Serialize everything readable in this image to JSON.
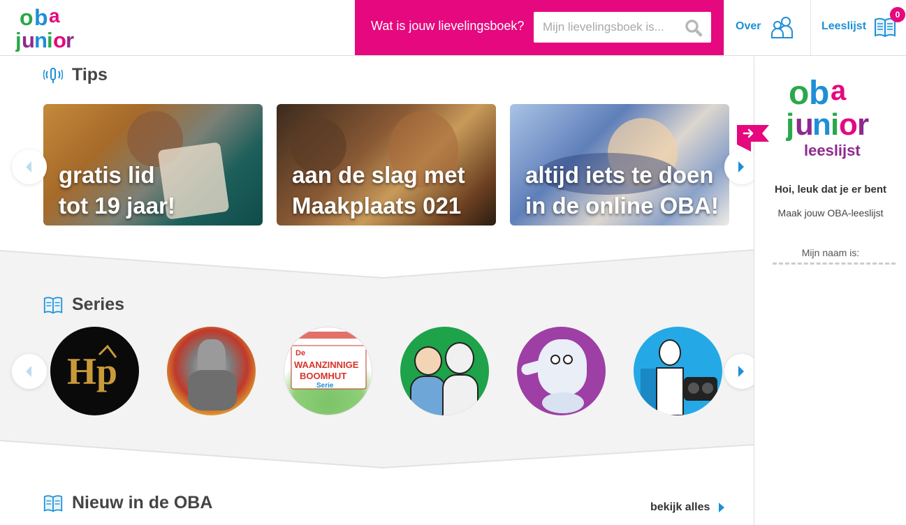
{
  "header": {
    "logo_top": "oba",
    "logo_bottom": "junior",
    "search_prompt": "Wat is jouw lievelingsboek?",
    "search_placeholder": "Mijn lievelingsboek is...",
    "nav_over": "Over",
    "nav_leeslijst": "Leeslijst",
    "leeslijst_count": "0"
  },
  "tips": {
    "heading": "Tips",
    "cards": [
      {
        "line1": "gratis lid",
        "line2": "tot 19 jaar!"
      },
      {
        "line1": "aan de slag met",
        "line2": "Maakplaats 021"
      },
      {
        "line1": "altijd iets te doen",
        "line2": "in de online OBA!"
      }
    ]
  },
  "series": {
    "heading": "Series",
    "items": [
      {
        "name": "harry-potter",
        "label": "Hp"
      },
      {
        "name": "ridder",
        "label": ""
      },
      {
        "name": "waanzinnige-boomhut",
        "label_de": "De",
        "label_main1": "WAANZINNIGE",
        "label_main2": "BOOMHUT",
        "label_serie": "Serie"
      },
      {
        "name": "dikkie-dik",
        "label": ""
      },
      {
        "name": "monster",
        "label": ""
      },
      {
        "name": "leven-van-een-loser",
        "label": ""
      }
    ]
  },
  "nieuw": {
    "heading": "Nieuw in de OBA",
    "bekijk_alles": "bekijk alles"
  },
  "sidebar": {
    "logo_top": "oba",
    "logo_bottom": "junior",
    "logo_sub": "leeslijst",
    "greeting": "Hoi, leuk dat je er bent",
    "subtitle": "Maak jouw OBA-leeslijst",
    "name_label": "Mijn naam is:"
  },
  "colors": {
    "pink": "#e5087e",
    "blue": "#1e8fd6",
    "green": "#2aa84a",
    "purple": "#8e2a8e"
  }
}
